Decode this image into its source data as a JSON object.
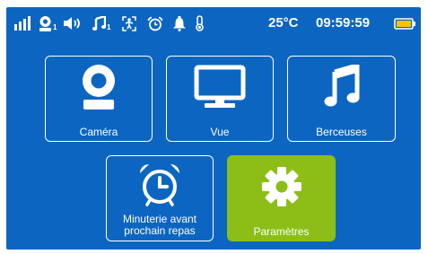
{
  "status_bar": {
    "icons": [
      "signal-strength-icon",
      "camera-count-icon",
      "volume-icon",
      "lullaby-icon",
      "motion-sensor-icon",
      "alarm-icon",
      "notification-bell-icon",
      "thermometer-icon",
      "battery-icon"
    ],
    "camera_count": "1",
    "lullaby_count": "1",
    "temperature": "25°C",
    "time": "09:59:59"
  },
  "menu": {
    "items": [
      {
        "label": "Caméra",
        "icon": "camera-icon",
        "selected": false
      },
      {
        "label": "Vue",
        "icon": "monitor-icon",
        "selected": false
      },
      {
        "label": "Berceuses",
        "icon": "music-note-icon",
        "selected": false
      },
      {
        "label_line1": "Minuterie avant",
        "label_line2": "prochain repas",
        "icon": "alarm-clock-icon",
        "selected": false
      },
      {
        "label": "Paramètres",
        "icon": "gear-icon",
        "selected": true
      }
    ]
  },
  "colors": {
    "background": "#0c66c1",
    "foreground": "#ffffff",
    "selected": "#8cbe17",
    "battery_level": "#f5c400"
  }
}
